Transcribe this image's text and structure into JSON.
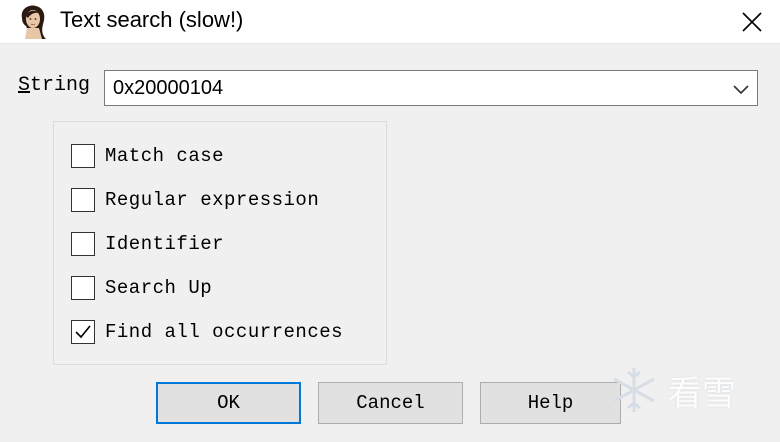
{
  "window": {
    "title": "Text search (slow!)",
    "app_icon": "portrait-icon",
    "close_icon": "close-icon"
  },
  "string_field": {
    "label_accel": "S",
    "label_rest": "tring",
    "value": "0x20000104",
    "dropdown_icon": "chevron-down-icon"
  },
  "options": [
    {
      "label": "Match case",
      "checked": false
    },
    {
      "label": "Regular expression",
      "checked": false
    },
    {
      "label": "Identifier",
      "checked": false
    },
    {
      "label": "Search Up",
      "checked": false
    },
    {
      "label": "Find all occurrences",
      "checked": true
    }
  ],
  "buttons": {
    "ok": "OK",
    "cancel": "Cancel",
    "help": "Help"
  },
  "watermark": {
    "text": "看雪",
    "icon": "snowflake-icon"
  },
  "colors": {
    "default_button_border": "#0078d7",
    "background": "#f0f0f0",
    "titlebar": "#ffffff"
  }
}
